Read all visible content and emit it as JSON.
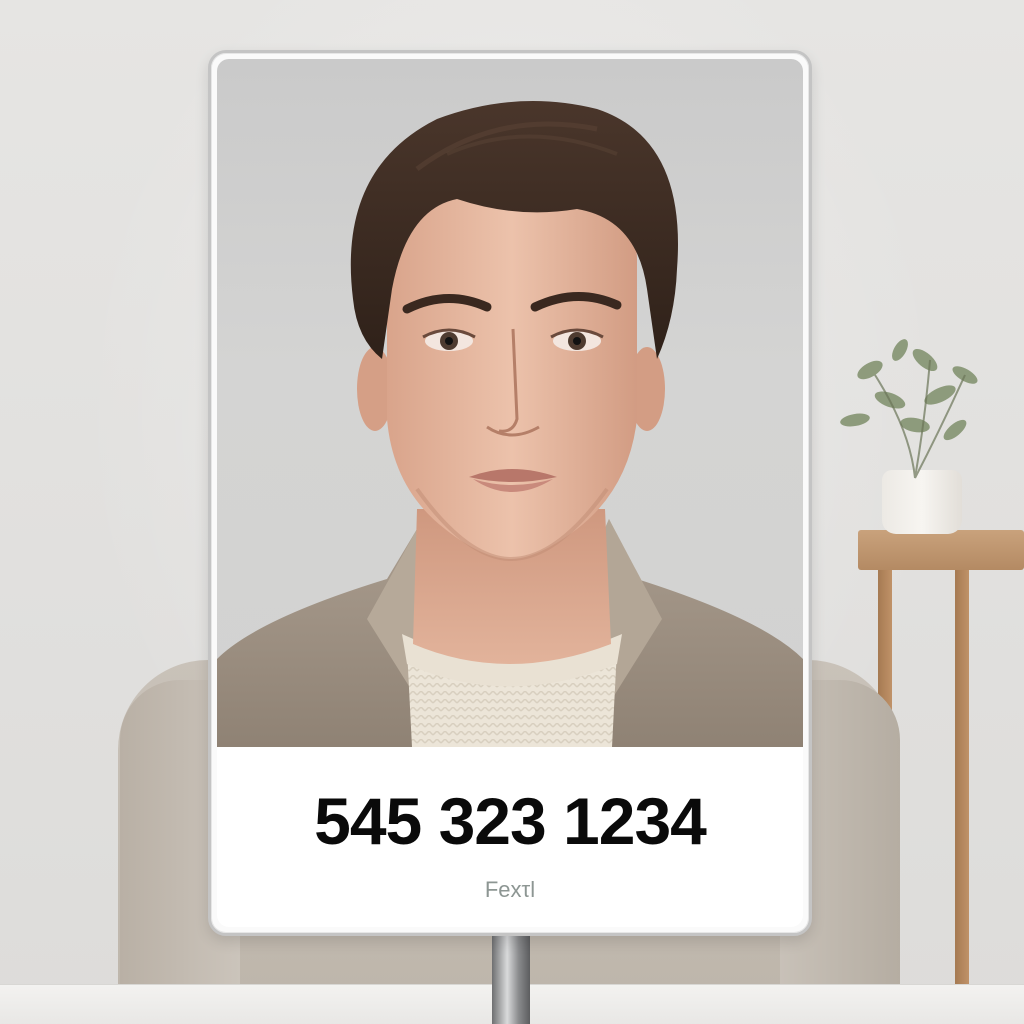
{
  "sign": {
    "phone_number": "545 323 1234",
    "brand_text": "Fexτl"
  },
  "colors": {
    "sign_background": "#ffffff",
    "sign_border": "#c4c4c4",
    "phone_text": "#0a0a0a",
    "brand_text": "#8d9693",
    "wall": "#e6e5e3",
    "coat": "#bdb5aa",
    "hair": "#3b2a21"
  },
  "icons": [
    "portrait-photo",
    "potted-plant-icon",
    "side-table",
    "sign-pole"
  ]
}
